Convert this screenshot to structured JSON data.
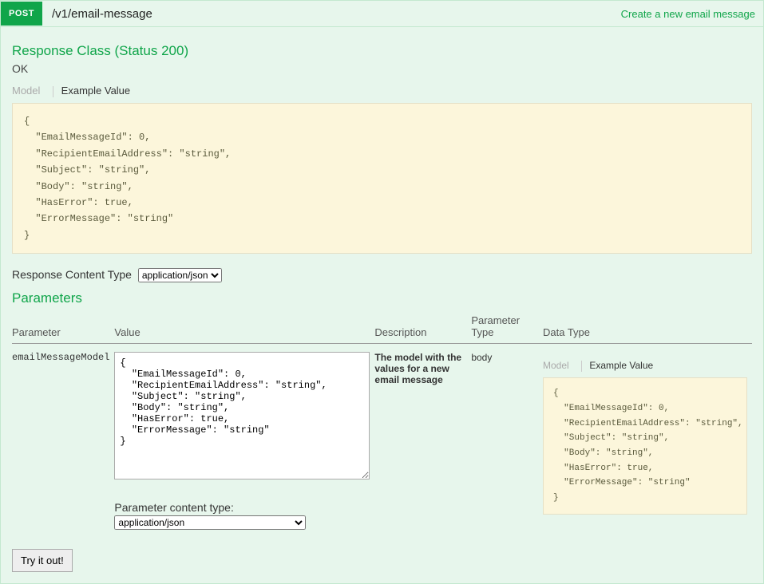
{
  "header": {
    "method": "POST",
    "path": "/v1/email-message",
    "summary": "Create a new email message"
  },
  "response": {
    "title": "Response Class (Status 200)",
    "status_text": "OK",
    "tabs": {
      "model": "Model",
      "example": "Example Value"
    },
    "example_json": "{\n  \"EmailMessageId\": 0,\n  \"RecipientEmailAddress\": \"string\",\n  \"Subject\": \"string\",\n  \"Body\": \"string\",\n  \"HasError\": true,\n  \"ErrorMessage\": \"string\"\n}",
    "content_type_label": "Response Content Type",
    "content_type_value": "application/json"
  },
  "parameters": {
    "title": "Parameters",
    "columns": {
      "parameter": "Parameter",
      "value": "Value",
      "description": "Description",
      "ptype": "Parameter Type",
      "dtype": "Data Type"
    },
    "row": {
      "name": "emailMessageModel",
      "value_json": "{\n  \"EmailMessageId\": 0,\n  \"RecipientEmailAddress\": \"string\",\n  \"Subject\": \"string\",\n  \"Body\": \"string\",\n  \"HasError\": true,\n  \"ErrorMessage\": \"string\"\n}",
      "description": "The model with the values for a new email message",
      "ptype": "body",
      "dtype_tabs": {
        "model": "Model",
        "example": "Example Value"
      },
      "dtype_example_json": "{\n  \"EmailMessageId\": 0,\n  \"RecipientEmailAddress\": \"string\",\n  \"Subject\": \"string\",\n  \"Body\": \"string\",\n  \"HasError\": true,\n  \"ErrorMessage\": \"string\"\n}"
    },
    "param_ct_label": "Parameter content type:",
    "param_ct_value": "application/json"
  },
  "actions": {
    "try": "Try it out!"
  }
}
